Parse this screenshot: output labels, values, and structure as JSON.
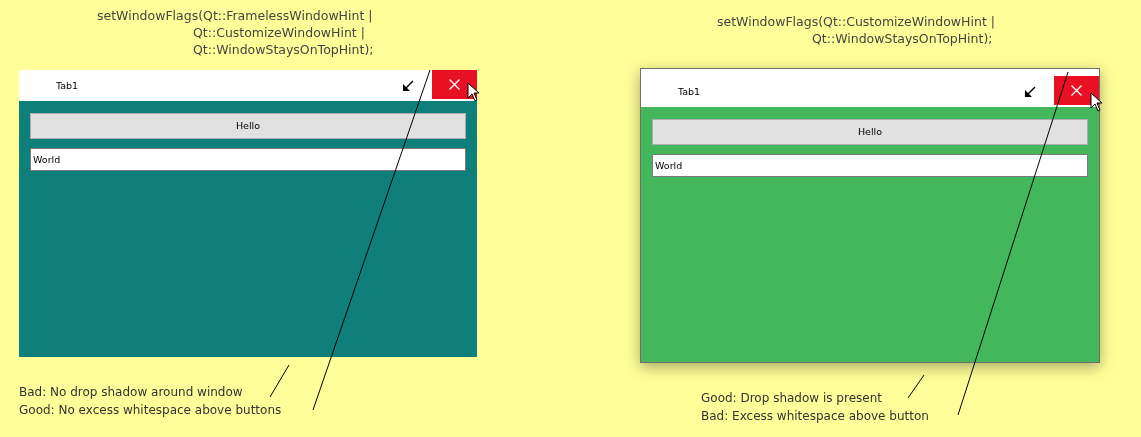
{
  "panels": [
    {
      "code_lines": [
        "setWindowFlags(Qt::FramelessWindowHint |",
        "Qt::CustomizeWindowHint |",
        "Qt::WindowStaysOnTopHint);"
      ],
      "window": {
        "tab": "Tab1",
        "frame": false,
        "shadow": false,
        "color": "#0e7f7a",
        "button": "Hello",
        "field_value": "World"
      },
      "notes": [
        "Bad: No drop shadow around window",
        "Good: No excess whitespace above buttons"
      ]
    },
    {
      "code_lines": [
        "setWindowFlags(Qt::CustomizeWindowHint |",
        "Qt::WindowStaysOnTopHint);"
      ],
      "window": {
        "tab": "Tab1",
        "frame": true,
        "shadow": true,
        "color": "#43b75c",
        "button": "Hello",
        "field_value": "World"
      },
      "notes": [
        "Good: Drop shadow is present",
        "Bad: Excess whitespace above button"
      ]
    }
  ]
}
